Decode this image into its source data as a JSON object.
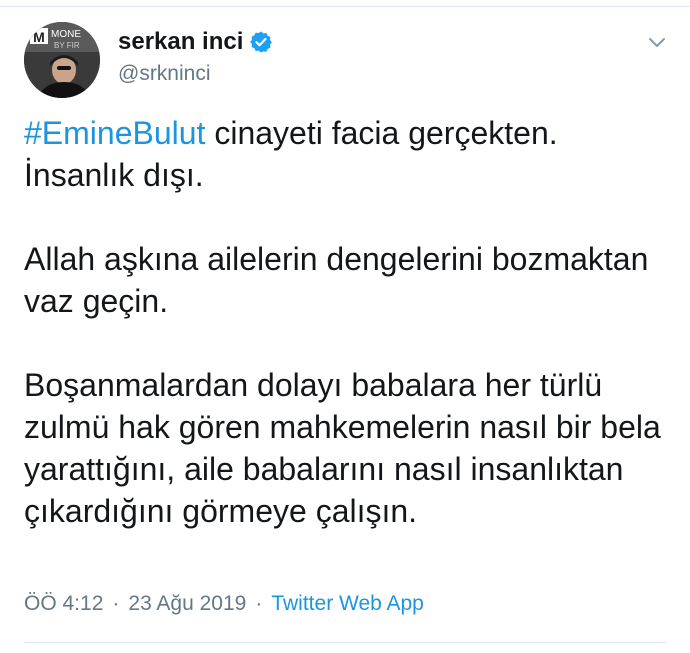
{
  "user": {
    "name": "serkan inci",
    "handle": "@srkninci",
    "avatar_text": "MONE",
    "avatar_subtext": "BY FIR"
  },
  "tweet": {
    "hashtag": "#EmineBulut",
    "line1_rest": " cinayeti facia gerçekten.",
    "line2": "İnsanlık dışı.",
    "para2": "Allah aşkına ailelerin dengelerini bozmaktan vaz geçin.",
    "para3": "Boşanmalardan dolayı babalara her türlü zulmü hak gören mahkemelerin nasıl bir bela yarattığını, aile babalarını nasıl insanlıktan çıkardığını görmeye çalışın."
  },
  "meta": {
    "time": "ÖÖ 4:12",
    "separator": "·",
    "date": "23 Ağu 2019",
    "source": "Twitter Web App"
  },
  "colors": {
    "link": "#1b95e0",
    "muted": "#657786",
    "text": "#14171a"
  },
  "icons": {
    "verified": "verified-badge-icon",
    "menu": "chevron-down-icon"
  }
}
